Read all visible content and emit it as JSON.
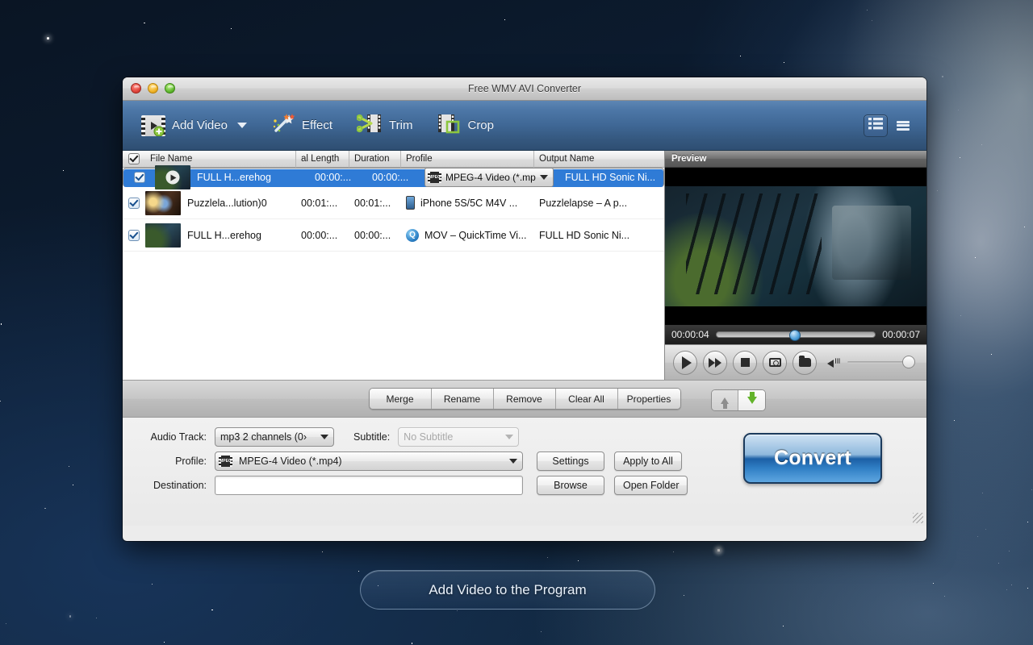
{
  "window": {
    "title": "Free WMV AVI Converter",
    "traffic_lights": [
      "close-button",
      "minimize-button",
      "zoom-button"
    ]
  },
  "toolbar": {
    "items": [
      {
        "label": "Add Video",
        "icon": "add-video-icon",
        "has_caret": true
      },
      {
        "label": "Effect",
        "icon": "effect-wand-icon",
        "has_caret": false
      },
      {
        "label": "Trim",
        "icon": "trim-scissors-icon",
        "has_caret": false
      },
      {
        "label": "Crop",
        "icon": "crop-icon",
        "has_caret": false
      }
    ],
    "view_detail_label": "detail-view-icon",
    "view_list_label": "list-view-icon"
  },
  "file_list": {
    "headers": {
      "checkbox": "select-all",
      "name": "File Name",
      "original_length": "al Length",
      "duration": "Duration",
      "profile": "Profile",
      "output_name": "Output Name"
    },
    "rows": [
      {
        "checked": true,
        "selected": true,
        "name": "FULL H...erehog",
        "original_length": "00:00:...",
        "duration": "00:00:...",
        "profile": "MPEG-4 Video (*.mp",
        "profile_icon": "mpeg-film-icon",
        "profile_is_dropdown": true,
        "output_name": "FULL HD Sonic  Ni...",
        "thumb": "t1",
        "has_play_overlay": true
      },
      {
        "checked": true,
        "selected": false,
        "name": "Puzzlela...lution)0",
        "original_length": "00:01:...",
        "duration": "00:01:...",
        "profile": "iPhone 5S/5C M4V ...",
        "profile_icon": "iphone-icon",
        "profile_is_dropdown": false,
        "output_name": "Puzzlelapse – A p...",
        "thumb": "t2",
        "has_play_overlay": false
      },
      {
        "checked": true,
        "selected": false,
        "name": "FULL H...erehog",
        "original_length": "00:00:...",
        "duration": "00:00:...",
        "profile": "MOV – QuickTime Vi...",
        "profile_icon": "quicktime-icon",
        "profile_is_dropdown": false,
        "output_name": "FULL HD Sonic  Ni...",
        "thumb": "t3",
        "has_play_overlay": false
      }
    ]
  },
  "preview": {
    "title": "Preview",
    "current_time": "00:00:04",
    "total_time": "00:00:07",
    "seek_percent": 46,
    "volume_percent": 100,
    "controls": [
      "play-button",
      "fast-forward-button",
      "stop-button",
      "snapshot-button",
      "open-folder-button"
    ]
  },
  "action_bar": {
    "buttons": [
      "Merge",
      "Rename",
      "Remove",
      "Clear All",
      "Properties"
    ],
    "move_up": "move-up-button",
    "move_down": "move-down-button"
  },
  "settings": {
    "audio_track_label": "Audio Track:",
    "audio_track_value": "mp3 2 channels (0›",
    "subtitle_label": "Subtitle:",
    "subtitle_value": "No Subtitle",
    "subtitle_disabled": true,
    "profile_label": "Profile:",
    "profile_value": "MPEG-4 Video (*.mp4)",
    "destination_label": "Destination:",
    "destination_value": "",
    "destination_placeholder": "",
    "settings_button": "Settings",
    "apply_all_button": "Apply to All",
    "browse_button": "Browse",
    "open_folder_button": "Open Folder",
    "convert_button": "Convert"
  },
  "dock": {
    "add_video_label": "Add Video to the Program"
  },
  "colors": {
    "toolbar_top": "#5d86b4",
    "toolbar_bottom": "#2e4e72",
    "selection_blue": "#2f7bd6",
    "convert_blue": "#2f7ec4",
    "green_accent": "#63b32a"
  }
}
